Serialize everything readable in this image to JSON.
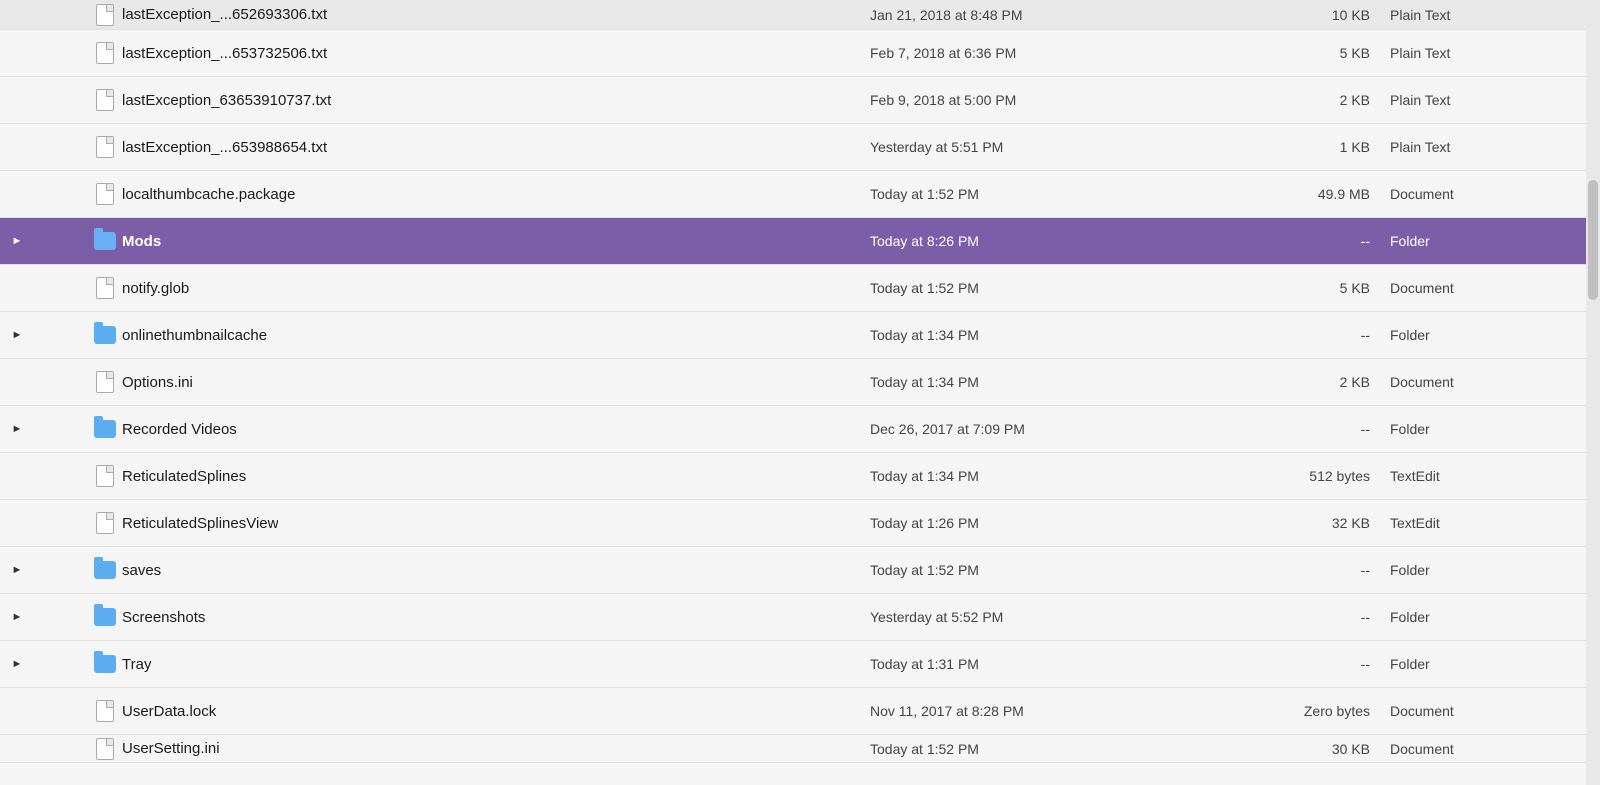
{
  "files": [
    {
      "id": 1,
      "name": "lastException_...652693306.txt",
      "date": "Jan 21, 2018 at 8:48 PM",
      "size": "10 KB",
      "type": "Plain Text",
      "kind": "doc",
      "expandable": false,
      "selected": false,
      "partial_top": true
    },
    {
      "id": 2,
      "name": "lastException_...653732506.txt",
      "date": "Feb 7, 2018 at 6:36 PM",
      "size": "5 KB",
      "type": "Plain Text",
      "kind": "doc",
      "expandable": false,
      "selected": false,
      "partial_top": false
    },
    {
      "id": 3,
      "name": "lastException_63653910737.txt",
      "date": "Feb 9, 2018 at 5:00 PM",
      "size": "2 KB",
      "type": "Plain Text",
      "kind": "doc",
      "expandable": false,
      "selected": false,
      "partial_top": false
    },
    {
      "id": 4,
      "name": "lastException_...653988654.txt",
      "date": "Yesterday at 5:51 PM",
      "size": "1 KB",
      "type": "Plain Text",
      "kind": "doc",
      "expandable": false,
      "selected": false,
      "partial_top": false
    },
    {
      "id": 5,
      "name": "localthumbcache.package",
      "date": "Today at 1:52 PM",
      "size": "49.9 MB",
      "type": "Document",
      "kind": "doc",
      "expandable": false,
      "selected": false,
      "partial_top": false
    },
    {
      "id": 6,
      "name": "Mods",
      "date": "Today at 8:26 PM",
      "size": "--",
      "type": "Folder",
      "kind": "folder",
      "expandable": true,
      "selected": true,
      "partial_top": false
    },
    {
      "id": 7,
      "name": "notify.glob",
      "date": "Today at 1:52 PM",
      "size": "5 KB",
      "type": "Document",
      "kind": "doc",
      "expandable": false,
      "selected": false,
      "partial_top": false
    },
    {
      "id": 8,
      "name": "onlinethumbnailcache",
      "date": "Today at 1:34 PM",
      "size": "--",
      "type": "Folder",
      "kind": "folder",
      "expandable": true,
      "selected": false,
      "partial_top": false
    },
    {
      "id": 9,
      "name": "Options.ini",
      "date": "Today at 1:34 PM",
      "size": "2 KB",
      "type": "Document",
      "kind": "doc",
      "expandable": false,
      "selected": false,
      "partial_top": false
    },
    {
      "id": 10,
      "name": "Recorded Videos",
      "date": "Dec 26, 2017 at 7:09 PM",
      "size": "--",
      "type": "Folder",
      "kind": "folder",
      "expandable": true,
      "selected": false,
      "partial_top": false
    },
    {
      "id": 11,
      "name": "ReticulatedSplines",
      "date": "Today at 1:34 PM",
      "size": "512 bytes",
      "type": "TextEdit",
      "kind": "doc",
      "expandable": false,
      "selected": false,
      "partial_top": false
    },
    {
      "id": 12,
      "name": "ReticulatedSplinesView",
      "date": "Today at 1:26 PM",
      "size": "32 KB",
      "type": "TextEdit",
      "kind": "doc",
      "expandable": false,
      "selected": false,
      "partial_top": false
    },
    {
      "id": 13,
      "name": "saves",
      "date": "Today at 1:52 PM",
      "size": "--",
      "type": "Folder",
      "kind": "folder",
      "expandable": true,
      "selected": false,
      "partial_top": false
    },
    {
      "id": 14,
      "name": "Screenshots",
      "date": "Yesterday at 5:52 PM",
      "size": "--",
      "type": "Folder",
      "kind": "folder",
      "expandable": true,
      "selected": false,
      "partial_top": false
    },
    {
      "id": 15,
      "name": "Tray",
      "date": "Today at 1:31 PM",
      "size": "--",
      "type": "Folder",
      "kind": "folder",
      "expandable": true,
      "selected": false,
      "partial_top": false
    },
    {
      "id": 16,
      "name": "UserData.lock",
      "date": "Nov 11, 2017 at 8:28 PM",
      "size": "Zero bytes",
      "type": "Document",
      "kind": "doc",
      "expandable": false,
      "selected": false,
      "partial_top": false
    },
    {
      "id": 17,
      "name": "UserSetting.ini",
      "date": "Today at 1:52 PM",
      "size": "30 KB",
      "type": "Document",
      "kind": "doc",
      "expandable": false,
      "selected": false,
      "partial_top": true,
      "partial_bottom": true
    }
  ]
}
